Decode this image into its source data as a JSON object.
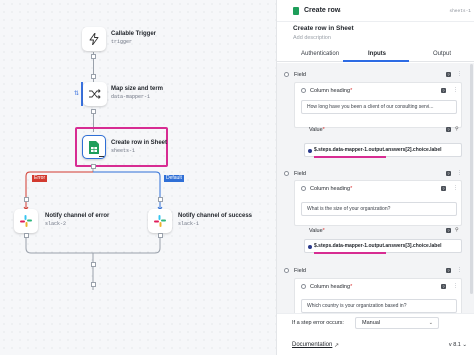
{
  "canvas": {
    "nodes": {
      "trigger": {
        "title": "Callable Trigger",
        "subtitle": "trigger"
      },
      "mapper": {
        "title": "Map size and term",
        "subtitle": "data-mapper-1"
      },
      "sheet": {
        "title": "Create row in Sheet",
        "subtitle": "sheets-1"
      },
      "slack_error": {
        "title": "Notify channel of error",
        "subtitle": "slack-2"
      },
      "slack_success": {
        "title": "Notify channel of success",
        "subtitle": "slack-1"
      }
    },
    "branches": {
      "error": "Error",
      "default": "Default"
    },
    "colors": {
      "error": "#d23a2f",
      "default": "#2f6fd6",
      "highlight": "#d72c92"
    }
  },
  "panel": {
    "title": "Create row",
    "id_label": "sheets-1",
    "name": "Create row in Sheet",
    "description_placeholder": "Add description",
    "tabs": [
      "Authentication",
      "Inputs",
      "Output"
    ],
    "active_tab": "Inputs",
    "fields": [
      {
        "label": "Field",
        "heading_label": "Column heading",
        "heading_value": "How long have you been a client of our consulting servi...",
        "value_label": "Value",
        "value": "$.steps.data-mapper-1.output.answers[2].choice.label"
      },
      {
        "label": "Field",
        "heading_label": "Column heading",
        "heading_value": "What is the size of your organization?",
        "value_label": "Value",
        "value": "$.steps.data-mapper-1.output.answers[3].choice.label"
      },
      {
        "label": "Field",
        "heading_label": "Column heading",
        "heading_value": "Which country is your organization based in?"
      }
    ],
    "footer": {
      "error_label": "If a step error occurs:",
      "error_option": "Manual",
      "documentation": "Documentation",
      "version": "v 8.1"
    }
  }
}
